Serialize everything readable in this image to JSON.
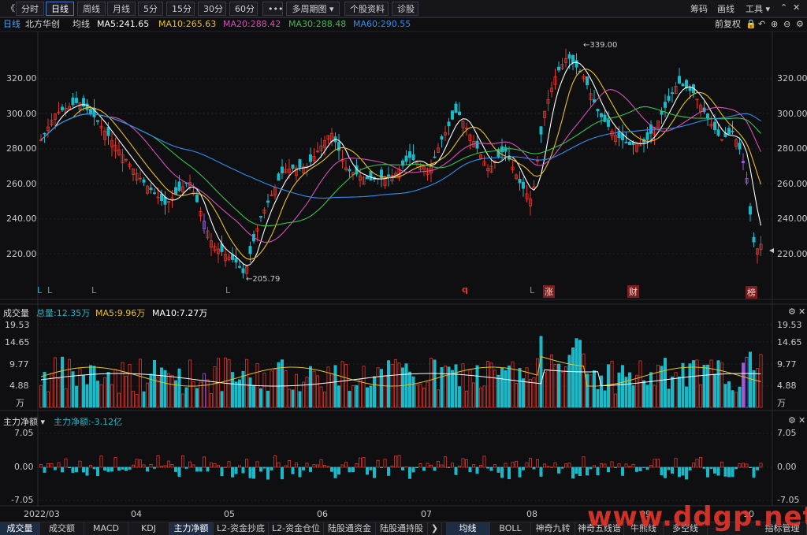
{
  "toolbar": {
    "back": "《",
    "buttons": [
      "分时",
      "日线",
      "周线",
      "月线",
      "5分",
      "15分",
      "30分",
      "60分",
      "•••",
      "多周期图 ▾",
      "个股资料",
      "诊股"
    ],
    "active": "日线",
    "right": [
      "筹码",
      "画线",
      "工具 ▾"
    ]
  },
  "header": {
    "period": "日线",
    "stock_name": "北方华创",
    "avg_label": "均线",
    "ma5": "MA5:241.65",
    "ma10": "MA10:265.63",
    "ma20": "MA20:288.42",
    "ma30": "MA30:288.48",
    "ma60": "MA60:290.55",
    "adjust": "前复权"
  },
  "main_chart": {
    "y_labels": [
      "320.00",
      "300.00",
      "280.00",
      "260.00",
      "240.00",
      "220.00"
    ],
    "high_label": "339.00",
    "low_label": "205.79",
    "markers": [
      "L",
      "L",
      "L",
      "L",
      "q",
      "L",
      "涨",
      "财",
      "榜"
    ]
  },
  "volume_panel": {
    "title": "成交量",
    "total": "总量:12.35万",
    "ma5": "MA5:9.96万",
    "ma10": "MA10:7.27万",
    "y_labels": [
      "19.53",
      "14.65",
      "9.77",
      "4.88",
      "万"
    ]
  },
  "flow_panel": {
    "title": "主力净额 ▾",
    "value": "主力净额:-3.12亿",
    "y_labels": [
      "7.05",
      "0.00",
      "-7.05"
    ]
  },
  "x_axis": [
    "2022/03",
    "04",
    "05",
    "06",
    "07",
    "08",
    "09",
    "10"
  ],
  "bottom_tabs_left": [
    "成交量",
    "成交额",
    "MACD",
    "KDJ",
    "主力净额",
    "L2-资金抄底",
    "L2-资金仓位",
    "陆股通资金",
    "陆股通持股"
  ],
  "bottom_tabs_right": [
    "均线",
    "BOLL",
    "神奇九转",
    "神奇五线谱",
    "牛熊线",
    "多空线",
    "指标管理"
  ],
  "watermark": "www.ddgp.net",
  "colors": {
    "up": "#e0352b",
    "down": "#19b9c9",
    "ma5": "#ffffff",
    "ma10": "#e8c21d",
    "ma20": "#d44fb5",
    "ma30": "#34c24b",
    "ma60": "#2e8ef0",
    "purple": "#9a5ad9"
  }
}
